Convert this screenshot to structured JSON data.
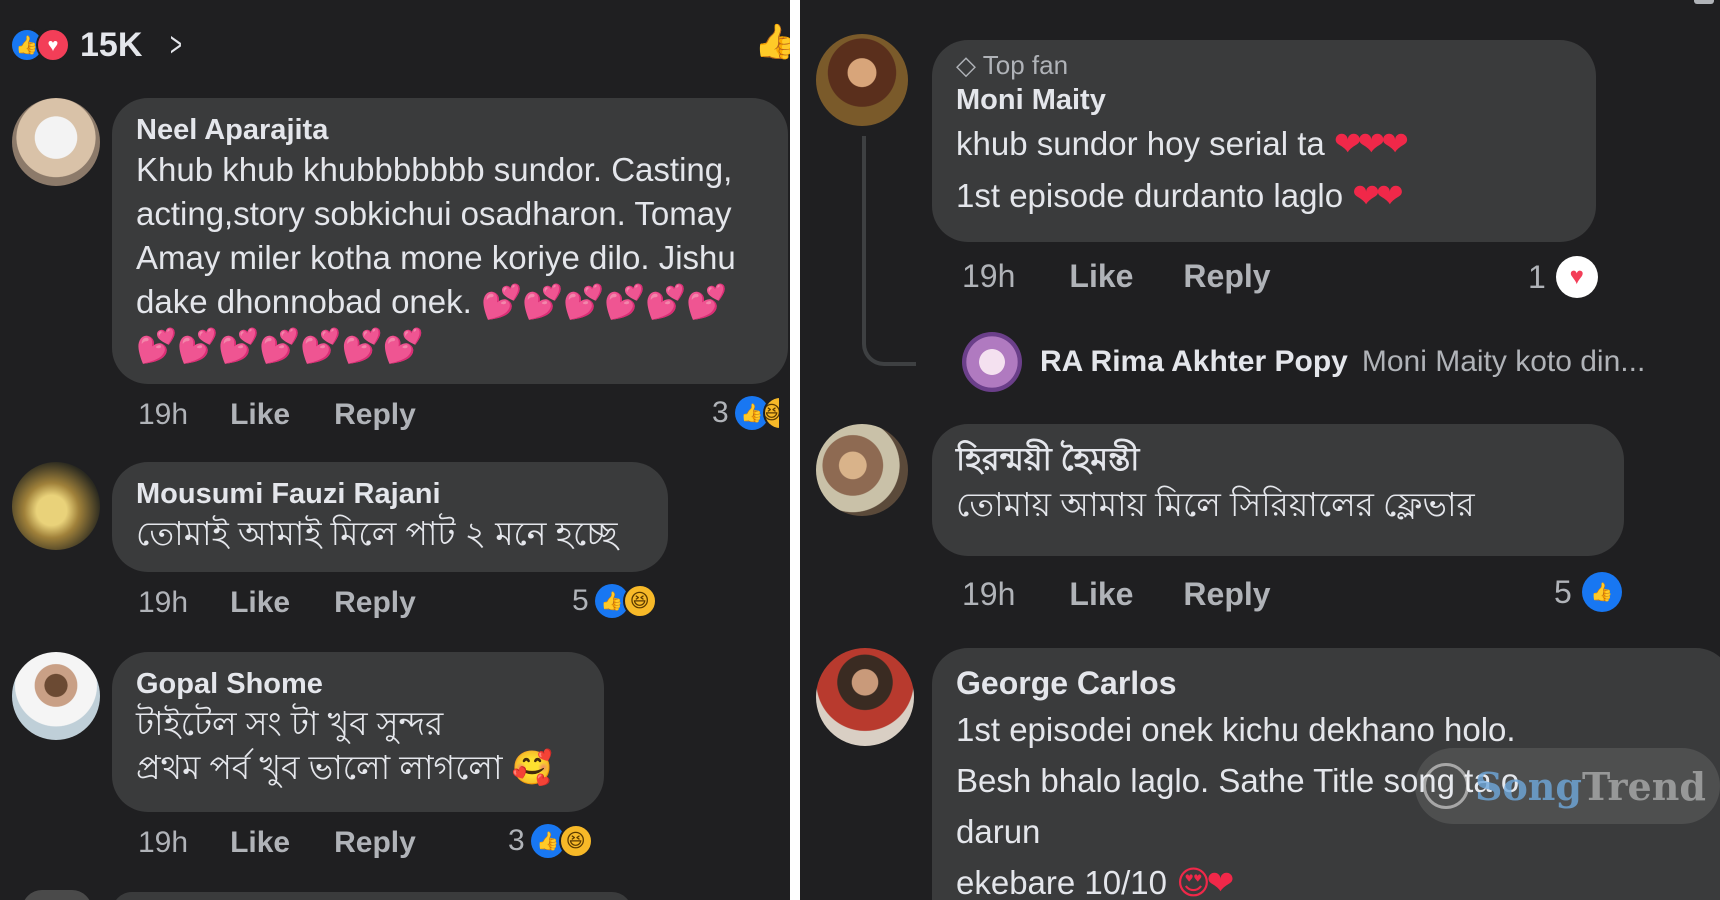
{
  "left": {
    "reaction_count": "15K",
    "comments": [
      {
        "author": "Neel Aparajita",
        "lines": [
          "Khub khub khubbbbbbb sundor. Casting,",
          "acting,story sobkichui osadharon. Tomay",
          "Amay miler kotha mone koriye dilo. Jishu",
          "dake dhonnobad onek."
        ],
        "emoji_line_1": "💕💕💕💕💕💕",
        "emoji_line_2": "💕💕💕💕💕💕💕",
        "time": "19h",
        "like": "Like",
        "reply": "Reply",
        "reactions": "3"
      },
      {
        "author": "Mousumi Fauzi Rajani",
        "lines": [
          "তোমাই আমাই মিলে পাট ২ মনে হচ্ছে"
        ],
        "time": "19h",
        "like": "Like",
        "reply": "Reply",
        "reactions": "5"
      },
      {
        "author": "Gopal  Shome",
        "lines": [
          "টাইটেল সং টা খুব সুন্দর",
          "প্রথম পর্ব খুব ভালো লাগলো"
        ],
        "emoji": "🥰",
        "time": "19h",
        "like": "Like",
        "reply": "Reply",
        "reactions": "3"
      }
    ]
  },
  "right": {
    "comments": [
      {
        "badge": "Top fan",
        "author": "Moni Maity",
        "lines": [
          "khub sundor hoy serial ta",
          "1st episode durdanto laglo"
        ],
        "hearts_1": "❤❤❤",
        "hearts_2": "❤❤",
        "time": "19h",
        "like": "Like",
        "reply": "Reply",
        "reactions": "1",
        "reply_preview": {
          "author": "RA Rima Akhter Popy",
          "text": "Moni Maity  koto din..."
        }
      },
      {
        "author": "হিরন্ময়ী হৈমন্তী",
        "lines": [
          "তোমায় আমায় মিলে সিরিয়ালের ফ্লেভার"
        ],
        "time": "19h",
        "like": "Like",
        "reply": "Reply",
        "reactions": "5"
      },
      {
        "author": "George Carlos",
        "lines": [
          "1st episodei onek kichu dekhano holo.",
          "Besh bhalo laglo. Sathe Title song ta o",
          "darun",
          " ekebare 10/10"
        ],
        "emoji": "😍❤",
        "time": "",
        "like": "",
        "reply": "",
        "reactions": ""
      }
    ],
    "watermark": {
      "part1": "Song",
      "part2": "Trend"
    }
  },
  "colors": {
    "background": "#1f1f21",
    "bubble": "#3a3b3c",
    "like_blue": "#1877f2",
    "love_red": "#f33e58"
  }
}
